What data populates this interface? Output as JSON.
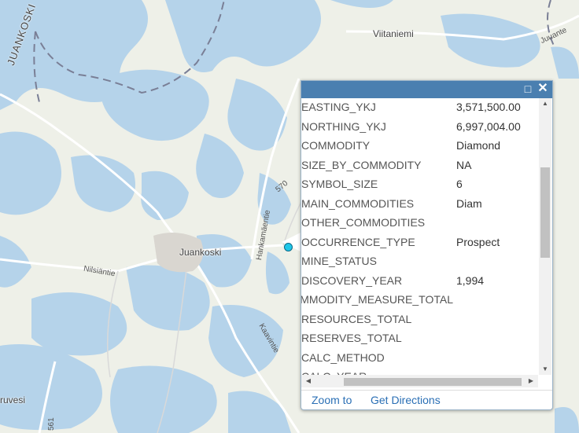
{
  "map": {
    "places": [
      {
        "id": "juankoski",
        "label": "Juankoski"
      },
      {
        "id": "viitaniemi",
        "label": "Viitaniemi"
      },
      {
        "id": "juankoski-region",
        "label": "JUANKOSKI"
      },
      {
        "id": "ruvesi",
        "label": "ruvesi"
      }
    ],
    "roads": [
      {
        "id": "nilsiantie",
        "label": "Nilsiäntie"
      },
      {
        "id": "hankamaentie",
        "label": "Hankamäentie"
      },
      {
        "id": "kaavintie",
        "label": "Kaavintie"
      },
      {
        "id": "juuantie",
        "label": "Juuante"
      },
      {
        "id": "r570",
        "label": "570"
      },
      {
        "id": "r561",
        "label": "561"
      }
    ],
    "colors": {
      "water": "#b5d3ea",
      "land": "#eef0e8",
      "road": "#ffffff",
      "border": "#6b6b8a",
      "header": "#4a7fb0"
    }
  },
  "popup": {
    "maximize_icon": "maximize-icon",
    "close_icon": "close-icon",
    "attributes": [
      {
        "name": "EASTING_YKJ",
        "value": "3,571,500.00"
      },
      {
        "name": "NORTHING_YKJ",
        "value": "6,997,004.00"
      },
      {
        "name": "COMMODITY",
        "value": "Diamond"
      },
      {
        "name": "SIZE_BY_COMMODITY",
        "value": "NA"
      },
      {
        "name": "SYMBOL_SIZE",
        "value": "6"
      },
      {
        "name": "MAIN_COMMODITIES",
        "value": "Diam"
      },
      {
        "name": "OTHER_COMMODITIES",
        "value": ""
      },
      {
        "name": "OCCURRENCE_TYPE",
        "value": "Prospect"
      },
      {
        "name": "MINE_STATUS",
        "value": ""
      },
      {
        "name": "DISCOVERY_YEAR",
        "value": "1,994"
      },
      {
        "name": "COMMODITY_MEASURE_TOTAL",
        "value": ""
      },
      {
        "name": "RESOURCES_TOTAL",
        "value": ""
      },
      {
        "name": "RESERVES_TOTAL",
        "value": ""
      },
      {
        "name": "CALC_METHOD",
        "value": ""
      },
      {
        "name": "CALC_YEAR",
        "value": ""
      }
    ],
    "footer": {
      "zoom_to": "Zoom to",
      "get_directions": "Get Directions"
    }
  }
}
